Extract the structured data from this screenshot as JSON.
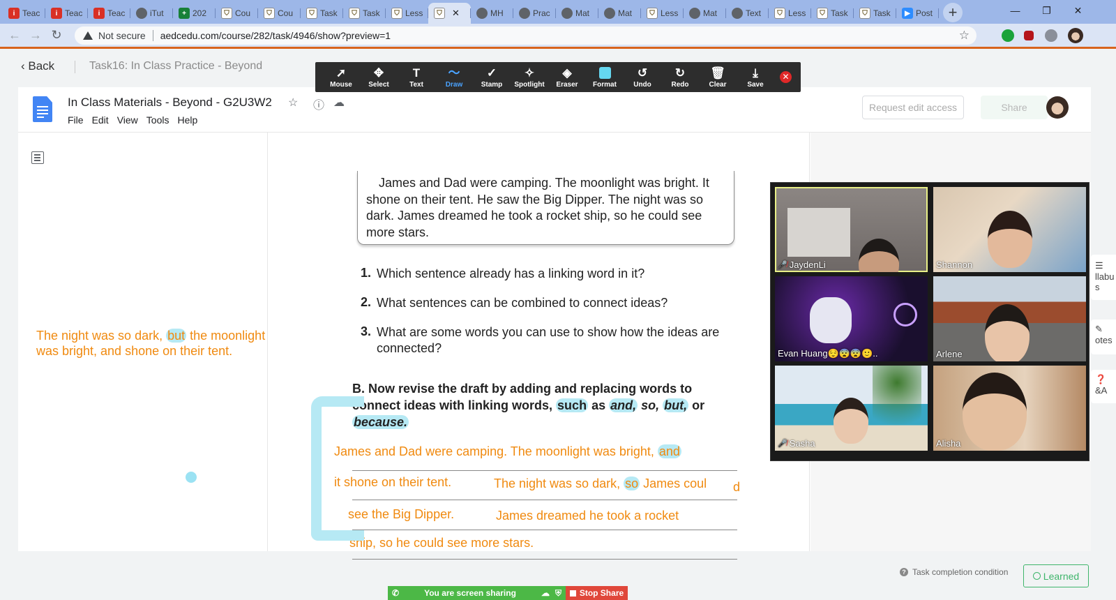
{
  "browser": {
    "tabs": [
      {
        "label": "Teac",
        "icon": "i"
      },
      {
        "label": "Teac",
        "icon": "i"
      },
      {
        "label": "Teac",
        "icon": "i"
      },
      {
        "label": "iTut",
        "icon": "g"
      },
      {
        "label": "202",
        "icon": "plus"
      },
      {
        "label": "Cou",
        "icon": "doc"
      },
      {
        "label": "Cou",
        "icon": "doc"
      },
      {
        "label": "Task",
        "icon": "doc"
      },
      {
        "label": "Task",
        "icon": "doc"
      },
      {
        "label": "Less",
        "icon": "doc"
      },
      {
        "label": "",
        "icon": "doc",
        "active": true
      },
      {
        "label": "MH",
        "icon": "g"
      },
      {
        "label": "Prac",
        "icon": "g"
      },
      {
        "label": "Mat",
        "icon": "g"
      },
      {
        "label": "Mat",
        "icon": "g"
      },
      {
        "label": "Less",
        "icon": "doc"
      },
      {
        "label": "Mat",
        "icon": "g"
      },
      {
        "label": "Text",
        "icon": "g"
      },
      {
        "label": "Less",
        "icon": "doc"
      },
      {
        "label": "Task",
        "icon": "doc"
      },
      {
        "label": "Task",
        "icon": "doc"
      },
      {
        "label": "Post",
        "icon": "zoom"
      }
    ],
    "security_label": "Not secure",
    "url": "aedcedu.com/course/282/task/4946/show?preview=1"
  },
  "course": {
    "back_label": "Back",
    "task_title": "Task16:  In Class Practice - Beyond"
  },
  "annotation_toolbar": {
    "tools": [
      {
        "label": "Mouse",
        "glyph": "➚"
      },
      {
        "label": "Select",
        "glyph": "✥"
      },
      {
        "label": "Text",
        "glyph": "T"
      },
      {
        "label": "Draw",
        "glyph": "〜",
        "active": true
      },
      {
        "label": "Stamp",
        "glyph": "✓"
      },
      {
        "label": "Spotlight",
        "glyph": "✧"
      },
      {
        "label": "Eraser",
        "glyph": "◈"
      },
      {
        "label": "Format",
        "glyph": ""
      },
      {
        "label": "Undo",
        "glyph": "↺"
      },
      {
        "label": "Redo",
        "glyph": "↻"
      },
      {
        "label": "Clear",
        "glyph": "🗑"
      },
      {
        "label": "Save",
        "glyph": "⤓"
      }
    ],
    "format_color": "#65d7f0"
  },
  "docs": {
    "title": "In Class Materials - Beyond - G2U3W2",
    "menu": [
      "File",
      "Edit",
      "View",
      "Tools",
      "Help"
    ],
    "request_edit_label": "Request edit access",
    "share_label": "Share"
  },
  "worksheet": {
    "passage": "James and Dad were camping. The moonlight was bright. It shone on their tent. He saw the Big Dipper. The night was so dark. James dreamed he took a rocket ship, so he could see more stars.",
    "questions": [
      {
        "num": "1.",
        "text": "Which sentence already has a linking word in it?"
      },
      {
        "num": "2.",
        "text": "What sentences can be combined to connect ideas?"
      },
      {
        "num": "3.",
        "text": "What are some words you can use to show how the ideas are connected?"
      }
    ],
    "part_b_lead": "B. Now revise the draft by adding and replacing words to connect ideas with linking words, ",
    "part_b_such": "such",
    "part_b_as": " as ",
    "part_b_words": [
      "and,",
      "so,",
      "but,"
    ],
    "part_b_or": " or ",
    "part_b_because": "because."
  },
  "handwriting": {
    "line1_a": "James and Dad were camping.  The moonlight was bright, ",
    "line1_and": "and",
    "line2_a": "it shone on their tent.",
    "line2_b": "The night was so dark, ",
    "line2_so": "so",
    "line2_c": " James coul",
    "line2_d": "d",
    "line3_a": "see the Big Dipper.",
    "line3_b": "James dreamed he took a rocket",
    "line4": "ship, so he could see more stars.",
    "left_note_a": "The night was so dark, ",
    "left_note_but": "but",
    "left_note_b": " the moonlight was bright, and shone on their tent."
  },
  "zoom": {
    "participants": [
      {
        "name": "JaydenLi",
        "muted": true,
        "speaking": true
      },
      {
        "name": "Shannon",
        "muted": false
      },
      {
        "name": "Evan Huang😌😨😨🙂..",
        "muted": false
      },
      {
        "name": "Arlene",
        "muted": false
      },
      {
        "name": "Sasha",
        "muted": true
      },
      {
        "name": "Alisha",
        "muted": false
      }
    ],
    "sharing_label": "You are screen sharing",
    "stop_label": "Stop Share"
  },
  "side_panel": {
    "syllabus_peek": "llabu s",
    "notes_peek": "otes",
    "qa_peek": "&A"
  },
  "footer": {
    "completion_label": "Task completion condition",
    "learned_label": "Learned"
  }
}
